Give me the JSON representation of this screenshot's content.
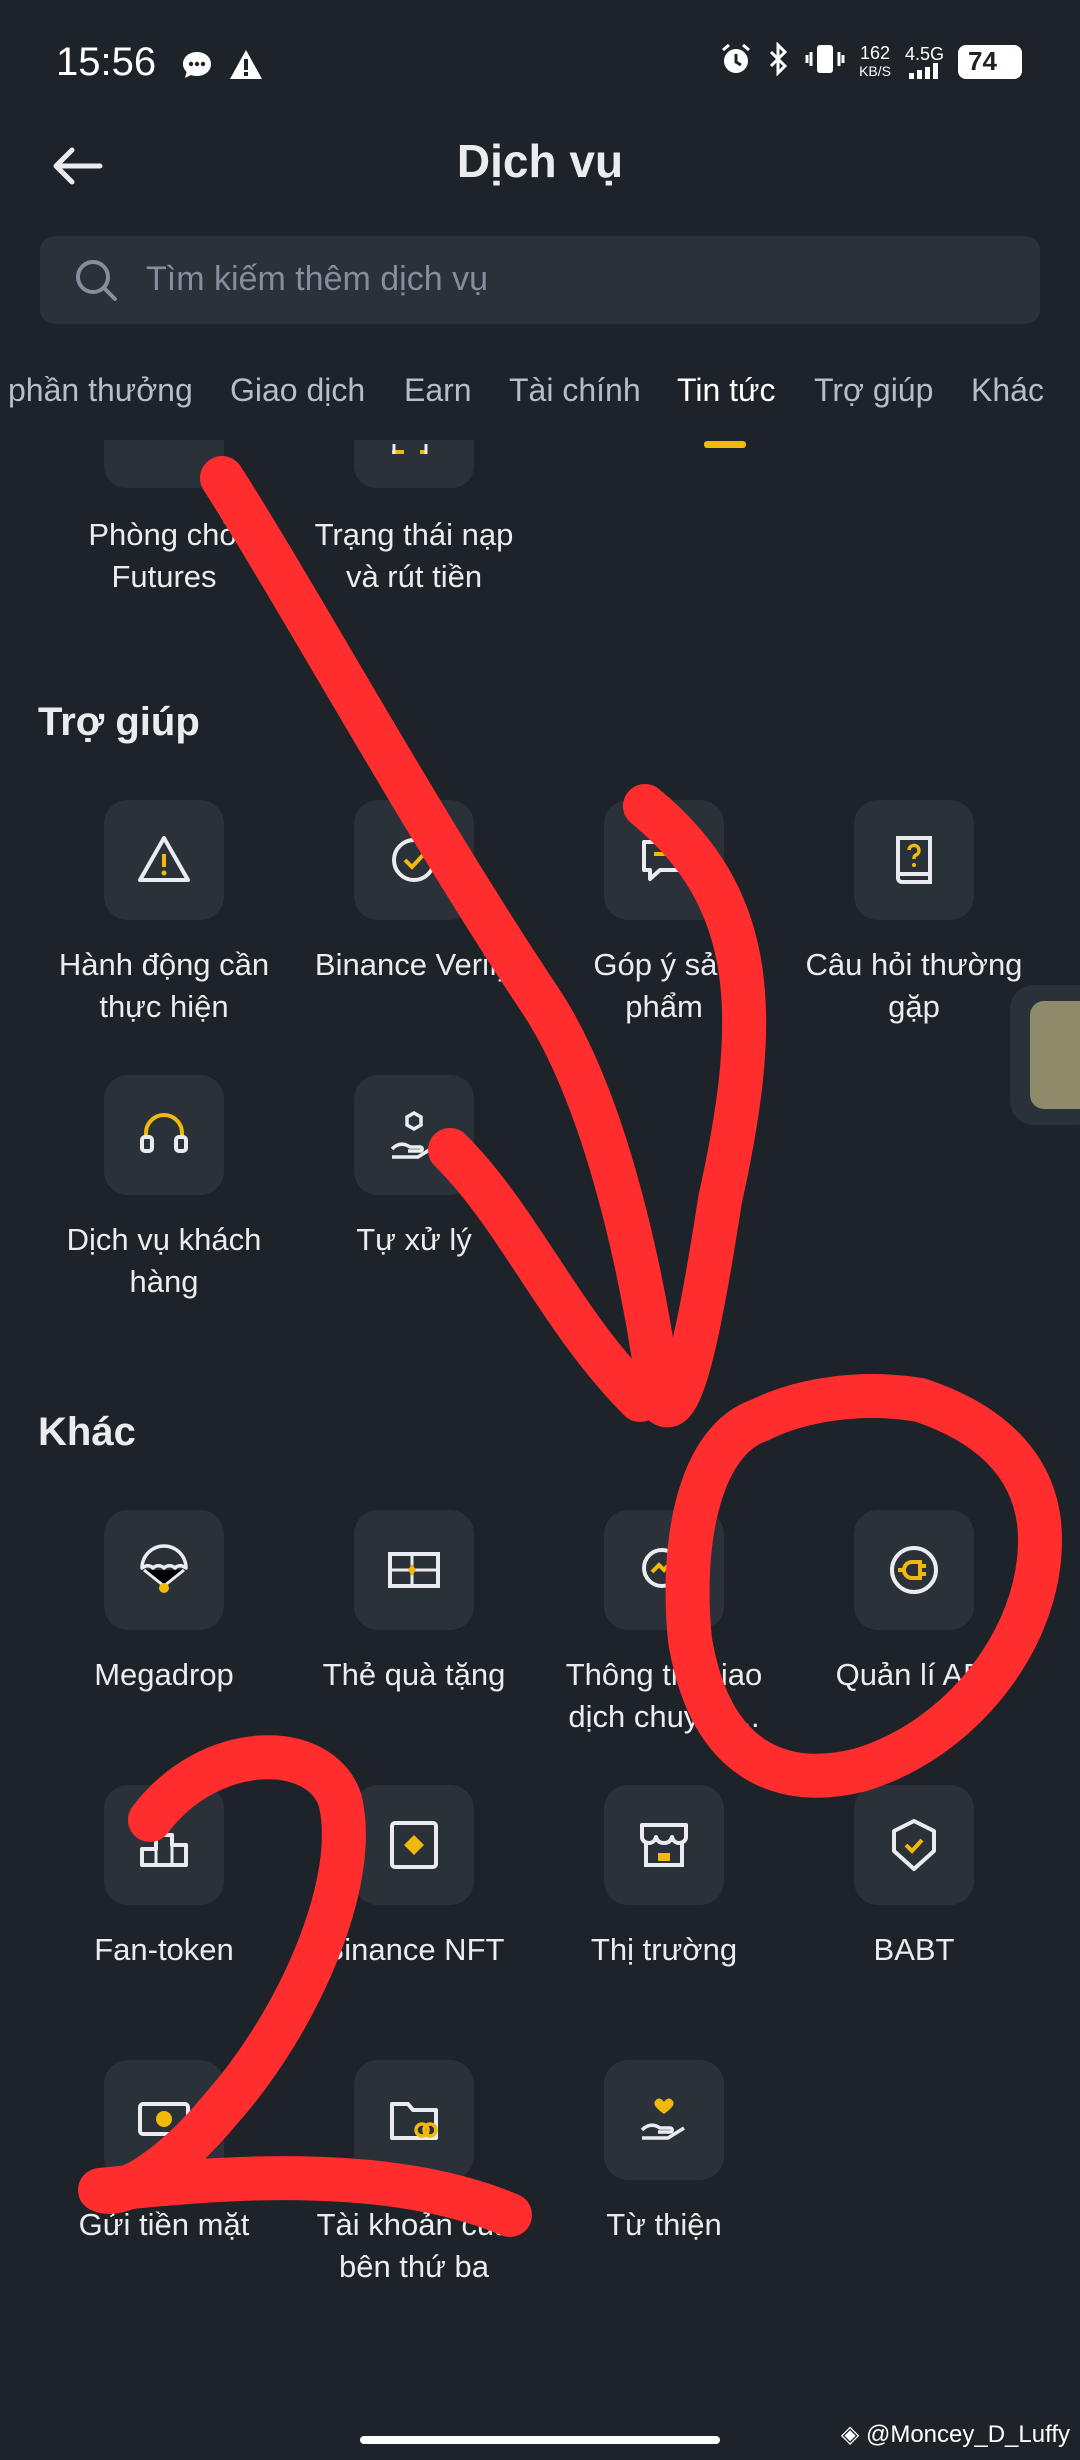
{
  "status": {
    "time": "15:56",
    "net_speed_top": "162",
    "net_speed_unit": "KB/S",
    "net_type": "4.5G",
    "battery": "74"
  },
  "header": {
    "title": "Dịch vụ"
  },
  "search": {
    "placeholder": "Tìm kiếm thêm dịch vụ"
  },
  "tabs": [
    "phần thưởng",
    "Giao dịch",
    "Earn",
    "Tài chính",
    "Tin tức",
    "Trợ giúp",
    "Khác"
  ],
  "active_tab": "Tin tức",
  "partial_row": [
    {
      "label_1": "Phòng chờ",
      "label_2": "Futures"
    },
    {
      "label_1": "Trạng thái nạp",
      "label_2": "và rút tiền"
    }
  ],
  "sections": {
    "help": {
      "title": "Trợ giúp",
      "items": [
        {
          "icon": "warning-icon",
          "label_1": "Hành động cần",
          "label_2": "thực hiện"
        },
        {
          "icon": "verify-icon",
          "label_1": "Binance Verify",
          "label_2": ""
        },
        {
          "icon": "feedback-icon",
          "label_1": "Góp ý sản",
          "label_2": "phẩm"
        },
        {
          "icon": "book-question-icon",
          "label_1": "Câu hỏi thường",
          "label_2": "gặp"
        },
        {
          "icon": "headset-icon",
          "label_1": "Dịch vụ khách",
          "label_2": "hàng"
        },
        {
          "icon": "self-service-icon",
          "label_1": "Tự xử lý",
          "label_2": ""
        }
      ]
    },
    "other": {
      "title": "Khác",
      "items": [
        {
          "icon": "parachute-icon",
          "label_1": "Megadrop",
          "label_2": ""
        },
        {
          "icon": "gift-card-icon",
          "label_1": "Thẻ quà tặng",
          "label_2": ""
        },
        {
          "icon": "chart-search-icon",
          "label_1": "Thông tin giao",
          "label_2": "dịch chuyên..."
        },
        {
          "icon": "plug-icon",
          "label_1": "Quản lí API",
          "label_2": ""
        },
        {
          "icon": "podium-icon",
          "label_1": "Fan-token",
          "label_2": ""
        },
        {
          "icon": "nft-icon",
          "label_1": "Binance NFT",
          "label_2": ""
        },
        {
          "icon": "store-icon",
          "label_1": "Thị trường",
          "label_2": ""
        },
        {
          "icon": "badge-icon",
          "label_1": "BABT",
          "label_2": ""
        },
        {
          "icon": "cash-icon",
          "label_1": "Gửi tiền mặt",
          "label_2": ""
        },
        {
          "icon": "folder-link-icon",
          "label_1": "Tài khoản của",
          "label_2": "bên thứ ba"
        },
        {
          "icon": "charity-icon",
          "label_1": "Từ thiện",
          "label_2": ""
        }
      ]
    }
  },
  "watermark": "@Moncey_D_Luffy",
  "colors": {
    "background": "#1e2329",
    "tile": "#2b3139",
    "accent": "#f0b90b",
    "annotation": "#ff2d2d"
  }
}
